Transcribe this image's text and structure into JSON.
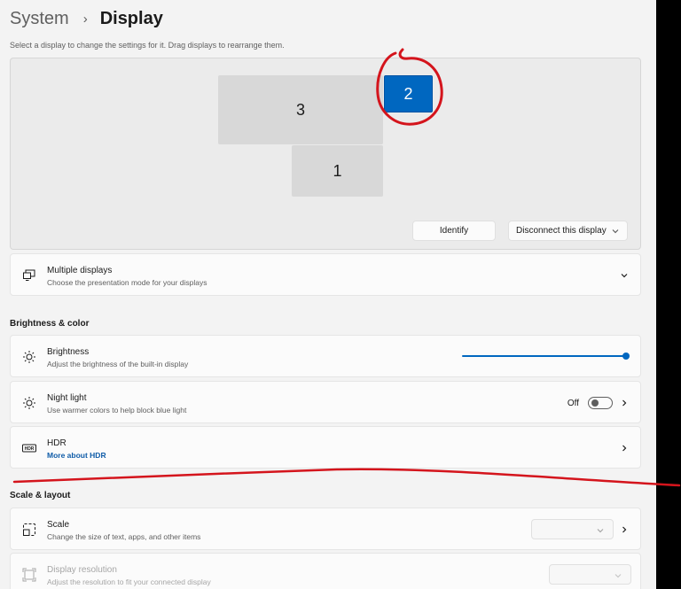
{
  "breadcrumb": {
    "parent": "System",
    "separator": "›",
    "current": "Display"
  },
  "hint": "Select a display to change the settings for it. Drag displays to rearrange them.",
  "arrangement": {
    "monitors": [
      {
        "label": "3",
        "selected": false
      },
      {
        "label": "2",
        "selected": true
      },
      {
        "label": "1",
        "selected": false
      }
    ],
    "identify_label": "Identify",
    "disconnect_label": "Disconnect this display"
  },
  "multiple_displays": {
    "title": "Multiple displays",
    "subtitle": "Choose the presentation mode for your displays"
  },
  "brightness_section": {
    "title": "Brightness & color"
  },
  "brightness": {
    "title": "Brightness",
    "subtitle": "Adjust the brightness of the built-in display",
    "value_fraction": 1.0
  },
  "night_light": {
    "title": "Night light",
    "subtitle": "Use warmer colors to help block blue light",
    "state": "Off"
  },
  "hdr": {
    "title": "HDR",
    "link": "More about HDR",
    "icon_text": "HDR"
  },
  "scale_section": {
    "title": "Scale & layout"
  },
  "scale": {
    "title": "Scale",
    "subtitle": "Change the size of text, apps, and other items"
  },
  "resolution": {
    "title": "Display resolution",
    "subtitle": "Adjust the resolution to fit your connected display"
  },
  "colors": {
    "accent": "#0067c0",
    "annotation": "#d4141c"
  }
}
